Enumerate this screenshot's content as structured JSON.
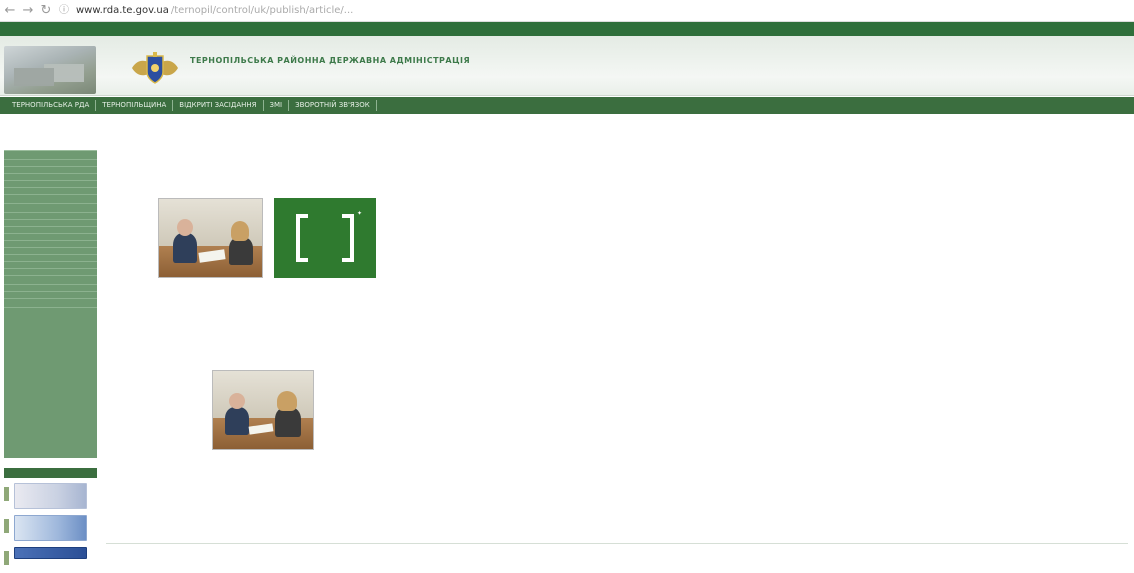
{
  "browser": {
    "back_icon": "arrow-left-icon",
    "forward_icon": "arrow-right-icon",
    "reload_icon": "reload-icon",
    "site_info_icon": "info-icon",
    "url_host": "www.rda.te.gov.ua",
    "url_path": "/ternopil/control/uk/publish/article/..."
  },
  "header": {
    "title": "ТЕРНОПІЛЬСЬКА РАЙОННА ДЕРЖАВНА АДМІНІСТРАЦІЯ",
    "subtitle": "",
    "colors": {
      "nav": "#3b6e3f",
      "sidebar": "#6f9a72",
      "accent": "#2f7a2f"
    }
  },
  "nav": {
    "items": [
      "ТЕРНОПІЛЬСЬКА РДА",
      "ТЕРНОПІЛЬЩИНА",
      "ВІДКРИТІ ЗАСІДАННЯ",
      "ЗМІ",
      "ЗВОРОТНІЙ ЗВ'ЯЗОК"
    ]
  },
  "sidebar": {
    "top_link": "",
    "sub_link": "",
    "menu": [
      "",
      "",
      "",
      "",
      "",
      "",
      "",
      "",
      "",
      "",
      "",
      "",
      "",
      "",
      "",
      "",
      "",
      "",
      "",
      "",
      ""
    ],
    "partners_heading": "",
    "partners": [
      {
        "name": ""
      },
      {
        "name": ""
      },
      {
        "name": ""
      }
    ]
  },
  "article": {
    "breadcrumb_link": "",
    "breadcrumb_sub": "",
    "breadcrumb_back": "",
    "date": "",
    "title": "",
    "lead": "",
    "logo_text": "",
    "paragraphs": [
      "",
      "",
      "",
      "",
      "",
      "",
      "",
      "",
      "",
      "",
      "",
      "",
      "",
      ""
    ],
    "bottom_link": ""
  }
}
